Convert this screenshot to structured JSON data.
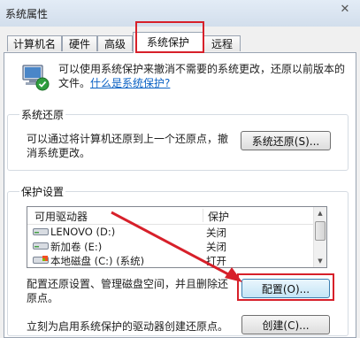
{
  "window": {
    "title": "系统属性",
    "close_glyph": "✕"
  },
  "tabs": [
    {
      "label": "计算机名"
    },
    {
      "label": "硬件"
    },
    {
      "label": "高级"
    },
    {
      "label": "系统保护",
      "active": true
    },
    {
      "label": "远程"
    }
  ],
  "intro": {
    "text": "可以使用系统保护来撤消不需要的系统更改，还原以前版本的文件。",
    "link": "什么是系统保护?"
  },
  "restore_group": {
    "title": "系统还原",
    "text": "可以通过将计算机还原到上一个还原点，撤消系统更改。",
    "button": "系统还原(S)..."
  },
  "protection_group": {
    "title": "保护设置",
    "columns": [
      "可用驱动器",
      "保护"
    ],
    "rows": [
      {
        "drive": "LENOVO  (D:)",
        "status": "关闭",
        "icon": "drive-icon"
      },
      {
        "drive": "新加卷  (E:)",
        "status": "关闭",
        "icon": "drive-icon"
      },
      {
        "drive": "本地磁盘 (C:) (系统)",
        "status": "打开",
        "icon": "system-drive-icon"
      }
    ],
    "scroll_up": "▲",
    "scroll_down": "▼",
    "config_text": "配置还原设置、管理磁盘空间，并且删除还原点。",
    "config_button": "配置(O)...",
    "create_text": "立刻为启用系统保护的驱动器创建还原点。",
    "create_button": "创建(C)..."
  },
  "colors": {
    "highlight": "#d7202a",
    "link": "#0b62c4"
  }
}
